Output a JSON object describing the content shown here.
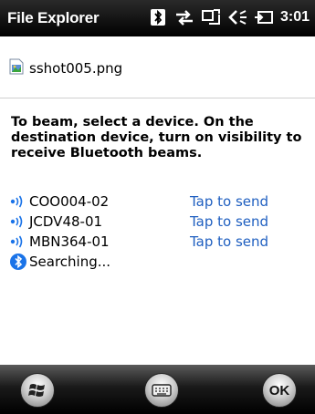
{
  "titlebar": {
    "app_title": "File Explorer",
    "time": "3:01",
    "icons": [
      "bluetooth-icon",
      "sync-arrows-icon",
      "connectivity-icon",
      "volume-icon",
      "battery-charging-icon"
    ]
  },
  "file": {
    "name": "sshot005.png",
    "icon": "image-file-icon"
  },
  "instructions": "To beam, select a device. On the destination device, turn on visibility to receive Bluetooth beams.",
  "devices": [
    {
      "name": "COO004-02",
      "action": "Tap to send"
    },
    {
      "name": "JCDV48-01",
      "action": "Tap to send"
    },
    {
      "name": "MBN364-01",
      "action": "Tap to send"
    }
  ],
  "searching_label": "Searching...",
  "bottombar": {
    "ok_label": "OK",
    "icons": [
      "windows-start-icon",
      "keyboard-icon",
      "ok-icon"
    ]
  },
  "colors": {
    "link": "#1f5fc0",
    "bluetooth": "#1a73e8",
    "titlebar_bg": "#000000"
  }
}
